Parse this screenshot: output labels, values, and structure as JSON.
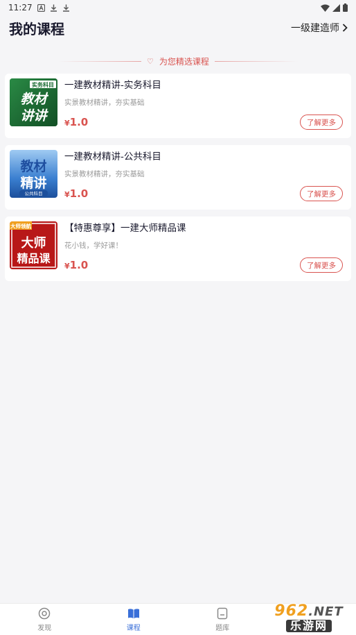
{
  "status_bar": {
    "time": "11:27",
    "left_icons": [
      "notification-a-icon",
      "download-icon",
      "download-icon"
    ],
    "right_icons": [
      "wifi-icon",
      "signal-icon",
      "battery-icon"
    ]
  },
  "header": {
    "title": "我的课程",
    "exam_selector": "一级建造师"
  },
  "section": {
    "heading": "为您精选课程"
  },
  "courses": [
    {
      "title": "一建教材精讲-实务科目",
      "desc": "实景教材精讲，夯实基础",
      "currency": "¥",
      "price": "1.0",
      "button": "了解更多",
      "thumb": {
        "badge": "实务科目",
        "line1": "教材",
        "line2": "讲讲",
        "bg": "#1f7a3a"
      }
    },
    {
      "title": "一建教材精讲-公共科目",
      "desc": "实景教材精讲，夯实基础",
      "currency": "¥",
      "price": "1.0",
      "button": "了解更多",
      "thumb": {
        "badge": "公共科目",
        "line1": "教材",
        "line2": "精讲",
        "bg": "#3a7fd0"
      }
    },
    {
      "title": "【特惠尊享】一建大师精品课",
      "desc": "花小钱，学好课！",
      "currency": "¥",
      "price": "1.0",
      "button": "了解更多",
      "thumb": {
        "badge": "大师领航",
        "line1": "大师",
        "line2": "精品课",
        "bg": "#c81e1e"
      }
    }
  ],
  "tab_bar": {
    "tabs": [
      {
        "label": "发现",
        "icon": "discover-icon",
        "active": false
      },
      {
        "label": "课程",
        "icon": "book-icon",
        "active": true
      },
      {
        "label": "题库",
        "icon": "question-bank-icon",
        "active": false
      }
    ]
  },
  "watermark": {
    "top": "962",
    "top_suffix": ".NET",
    "bottom": "乐游网"
  },
  "colors": {
    "accent_red": "#d9534f",
    "active_blue": "#3a6fd8"
  }
}
